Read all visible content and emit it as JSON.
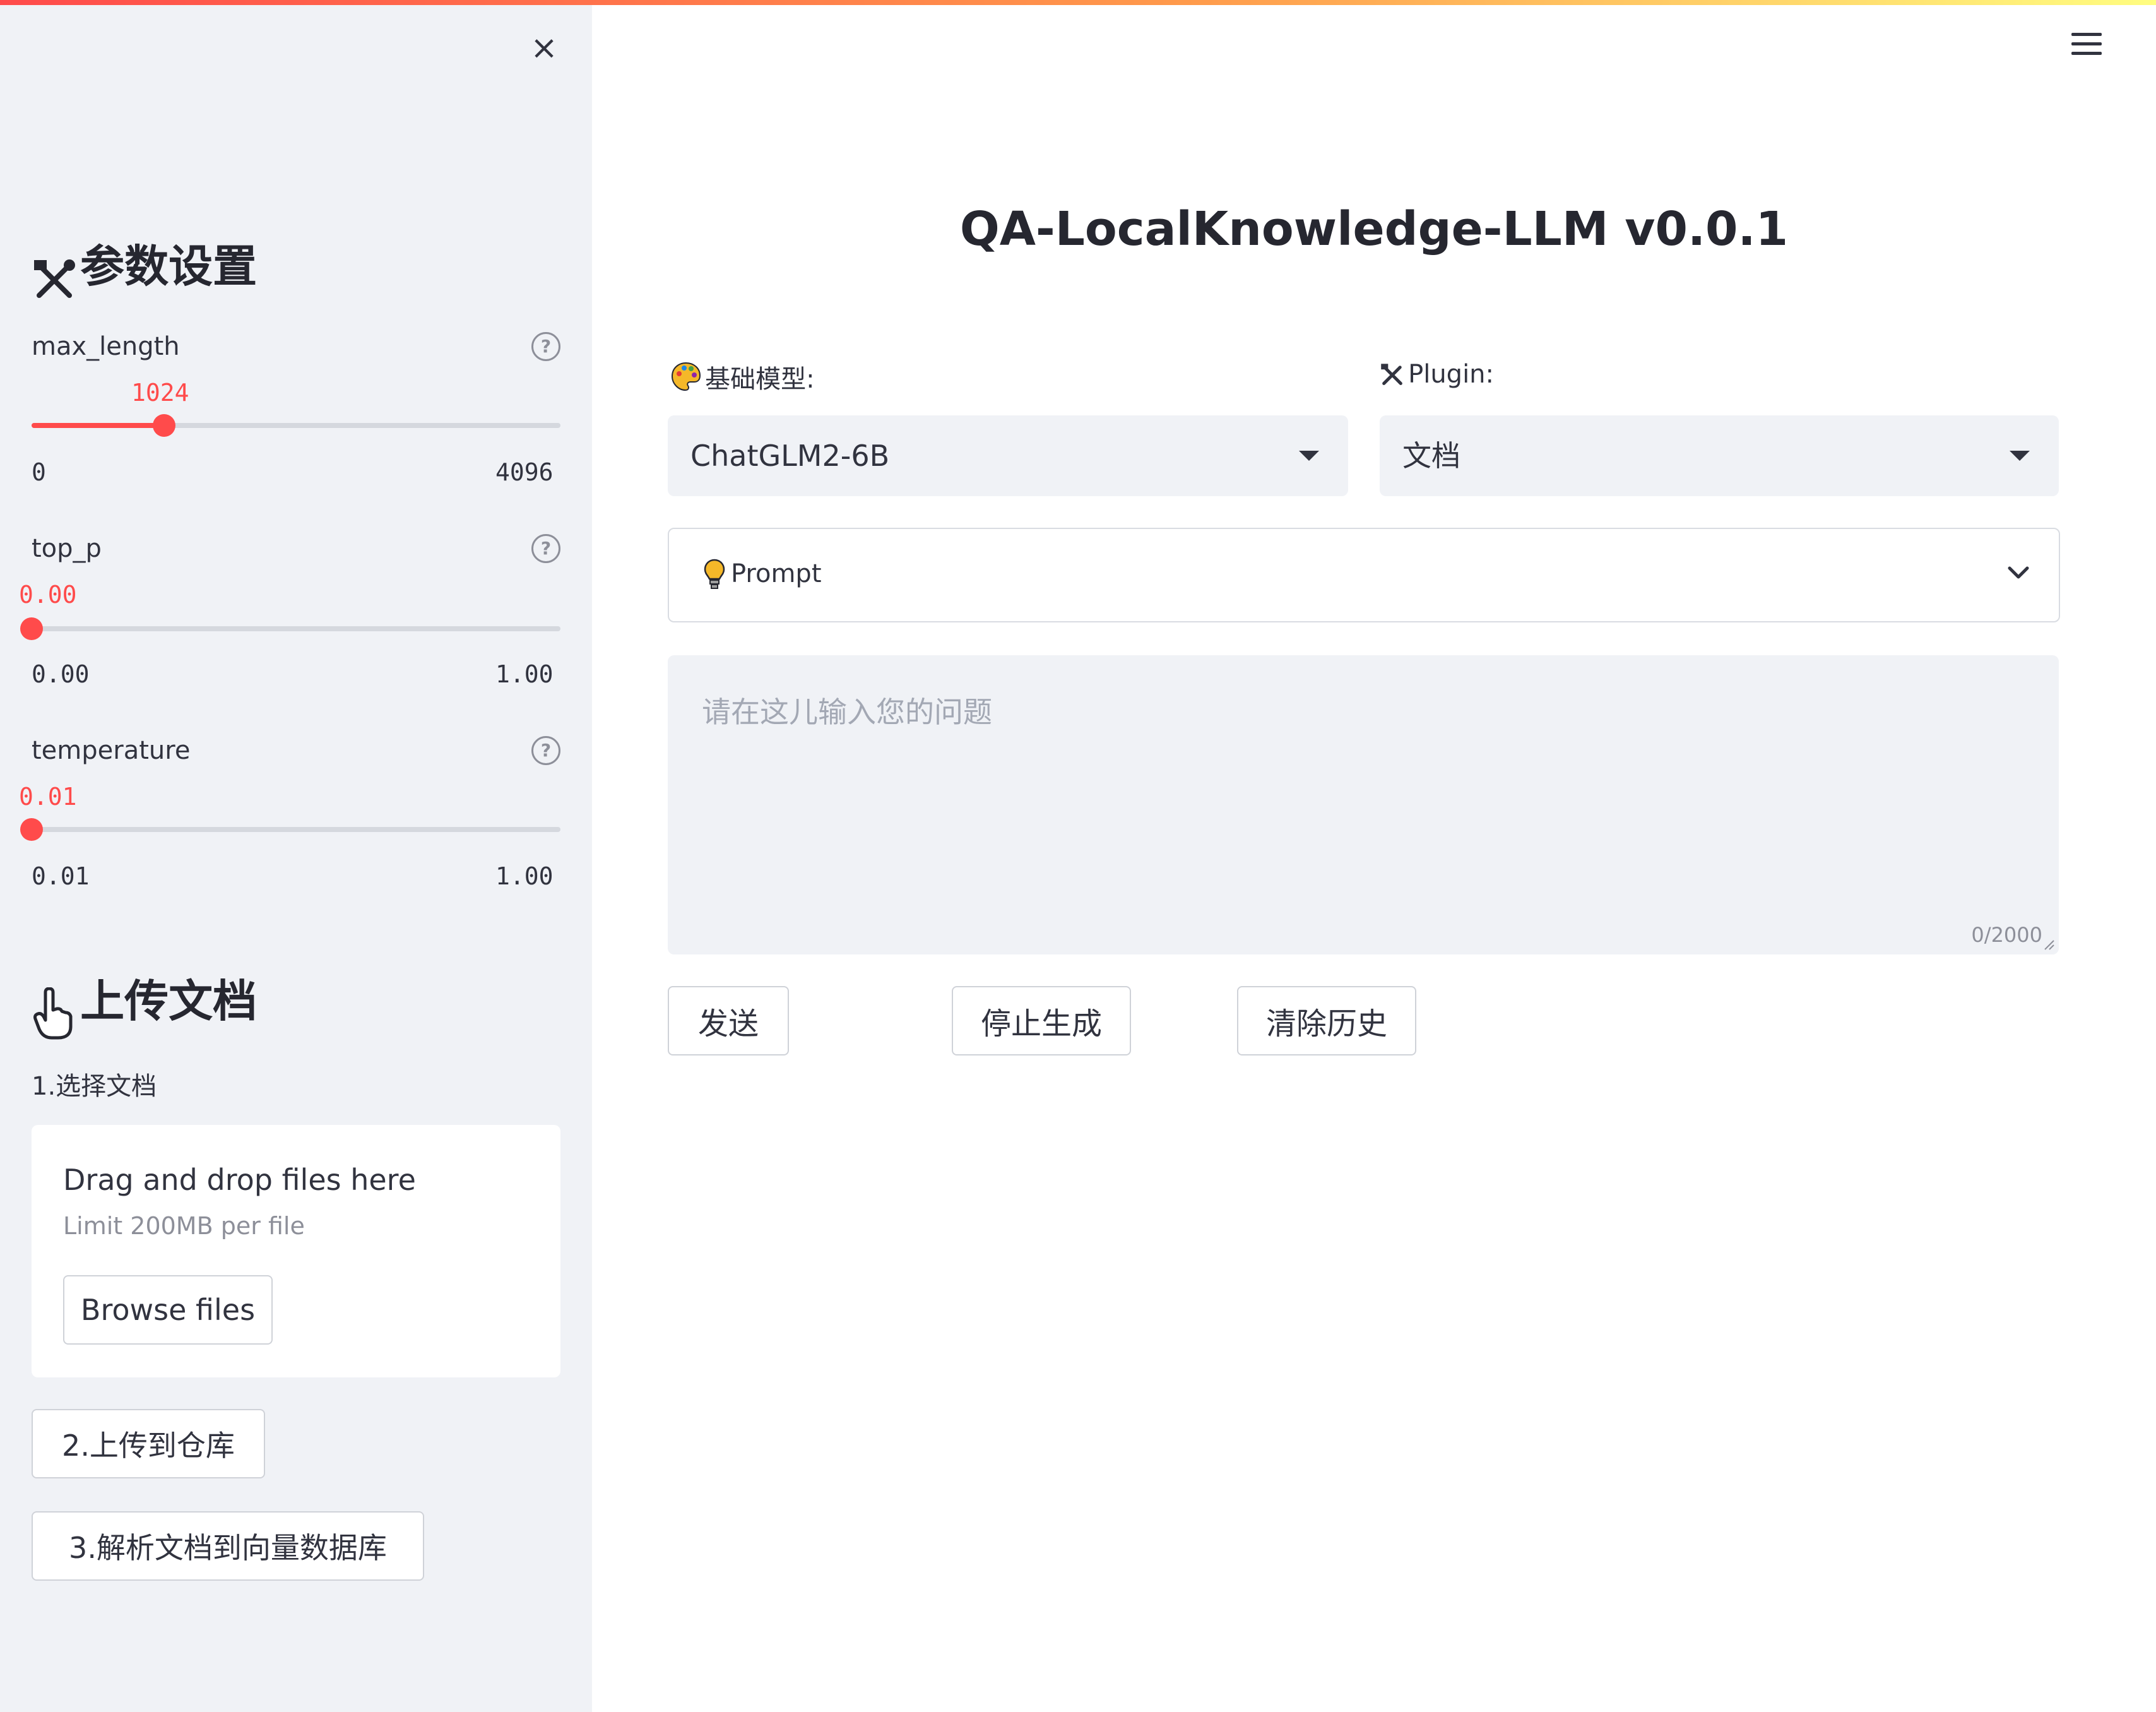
{
  "sidebar": {
    "params_heading": "参数设置",
    "sliders": [
      {
        "label": "max_length",
        "value": "1024",
        "min": "0",
        "max": "4096",
        "fraction": 0.25
      },
      {
        "label": "top_p",
        "value": "0.00",
        "min": "0.00",
        "max": "1.00",
        "fraction": 0.0
      },
      {
        "label": "temperature",
        "value": "0.01",
        "min": "0.01",
        "max": "1.00",
        "fraction": 0.0
      }
    ],
    "upload_heading": "上传文档",
    "step1_label": "1.选择文档",
    "dropzone": {
      "title": "Drag and drop files here",
      "limit": "Limit 200MB per file",
      "browse_label": "Browse files"
    },
    "step2_button": "2.上传到仓库",
    "step3_button": "3.解析文档到向量数据库"
  },
  "main": {
    "title": "QA-LocalKnowledge-LLM v0.0.1",
    "model_label": "基础模型:",
    "model_value": "ChatGLM2-6B",
    "plugin_label": "Plugin:",
    "plugin_value": "文档",
    "prompt_label": "Prompt",
    "input_placeholder": "请在这儿输入您的问题",
    "char_counter": "0/2000",
    "buttons": {
      "send": "发送",
      "stop": "停止生成",
      "clear": "清除历史"
    }
  },
  "colors": {
    "accent": "#ff4b4b",
    "sidebar_bg": "#f0f2f6"
  }
}
